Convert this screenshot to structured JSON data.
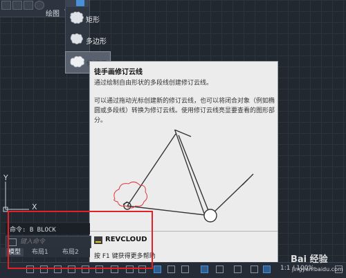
{
  "ribbon": {
    "panel_label": "绘图"
  },
  "flyout": {
    "items": [
      {
        "label": "矩形"
      },
      {
        "label": "多边形"
      },
      {
        "label": "修订云"
      }
    ]
  },
  "tooltip": {
    "title": "徒手画修订云线",
    "summary": "通过绘制自由形状的多段线创建修订云线。",
    "description": "可以通过拖动光标创建新的修订云线，也可以将闭合对象（例如椭圆或多段线）转换为修订云线。使用修订云线亮显要查看的图形部分。",
    "command": "REVCLOUD",
    "help": "按 F1 键获得更多帮助"
  },
  "command_line": {
    "history": "命令: B BLOCK",
    "placeholder": "键入命令"
  },
  "ucs": {
    "y_label": "Y",
    "x_label": "X"
  },
  "layout_tabs": [
    {
      "label": "模型"
    },
    {
      "label": "布局1"
    },
    {
      "label": "布局2"
    }
  ],
  "status_bar": {
    "scale": "1:1 / 100%"
  },
  "watermark": {
    "brand": "Bai 经验",
    "url": "jingyan.baidu.com"
  },
  "colors": {
    "highlight": "#e51f26",
    "accent": "#4a90d9",
    "cloud": "#e0383e"
  }
}
